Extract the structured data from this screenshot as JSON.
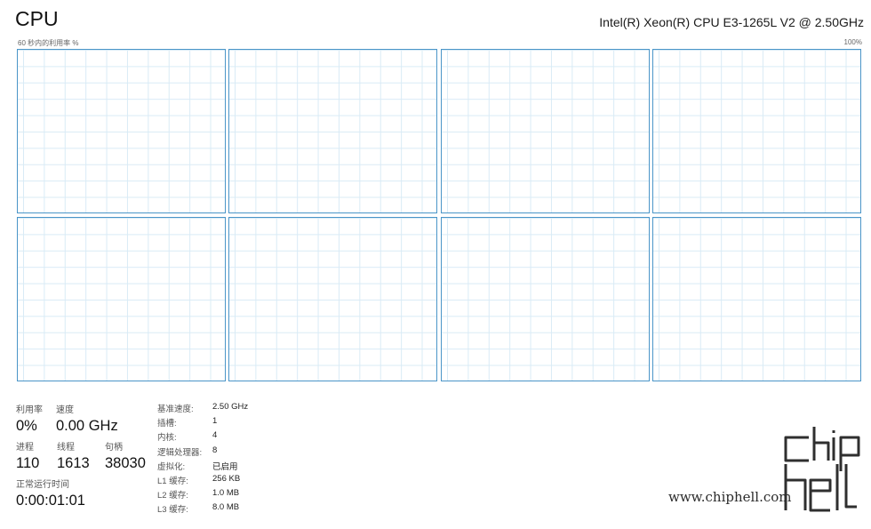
{
  "header": {
    "title": "CPU",
    "model": "Intel(R) Xeon(R) CPU E3-1265L V2 @ 2.50GHz",
    "graph_caption": "60 秒内的利用率 %",
    "graph_max": "100%"
  },
  "cores": [
    {
      "name": "core-1",
      "utilization": 0
    },
    {
      "name": "core-2",
      "utilization": 0
    },
    {
      "name": "core-3",
      "utilization": 0
    },
    {
      "name": "core-4",
      "utilization": 0
    },
    {
      "name": "core-5",
      "utilization": 0
    },
    {
      "name": "core-6",
      "utilization": 0
    },
    {
      "name": "core-7",
      "utilization": 0
    },
    {
      "name": "core-8",
      "utilization": 0
    }
  ],
  "stats": {
    "utilization": {
      "label": "利用率",
      "value": "0%"
    },
    "speed": {
      "label": "速度",
      "value": "0.00 GHz"
    },
    "processes": {
      "label": "进程",
      "value": "110"
    },
    "threads": {
      "label": "线程",
      "value": "1613"
    },
    "handles": {
      "label": "句柄",
      "value": "38030"
    },
    "uptime": {
      "label": "正常运行时间",
      "value": "0:00:01:01"
    }
  },
  "specs": [
    {
      "key": "基准速度:",
      "value": "2.50 GHz"
    },
    {
      "key": "插槽:",
      "value": "1"
    },
    {
      "key": "内核:",
      "value": "4"
    },
    {
      "key": "逻辑处理器:",
      "value": "8"
    },
    {
      "key": "虚拟化:",
      "value": "已启用"
    },
    {
      "key": "L1 缓存:",
      "value": "256 KB"
    },
    {
      "key": "L2 缓存:",
      "value": "1.0 MB"
    },
    {
      "key": "L3 缓存:",
      "value": "8.0 MB"
    }
  ],
  "watermark": {
    "logo": "chiphell",
    "url": "www.chiphell.com"
  }
}
